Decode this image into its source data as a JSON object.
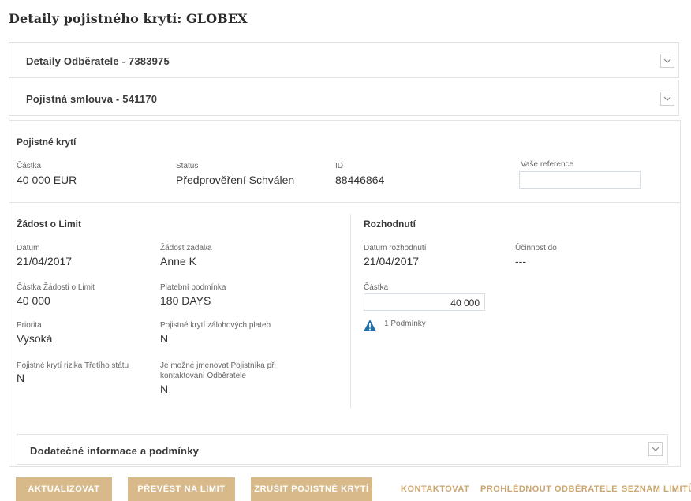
{
  "page": {
    "title": "Detaily pojistného krytí: GLOBEX"
  },
  "panels": {
    "customer": {
      "title": "Detaily Odběratele - 7383975"
    },
    "policy": {
      "title": "Pojistná smlouva - 541170"
    },
    "additional": {
      "title": "Dodatečné informace a podmínky"
    }
  },
  "coverage": {
    "title": "Pojistné krytí",
    "amount_label": "Částka",
    "amount_value": "40 000 EUR",
    "status_label": "Status",
    "status_value": "Předprověření Schválen",
    "id_label": "ID",
    "id_value": "88446864",
    "reference_label": "Vaše reference",
    "reference_value": ""
  },
  "request": {
    "title": "Žádost o Limit",
    "date_label": "Datum",
    "date_value": "21/04/2017",
    "requested_by_label": "Žádost zadal/a",
    "requested_by_value": "Anne K",
    "amount_label": "Částka Žádosti o Limit",
    "amount_value": "40 000",
    "payment_terms_label": "Platební podmínka",
    "payment_terms_value": "180 DAYS",
    "priority_label": "Priorita",
    "priority_value": "Vysoká",
    "advance_label": "Pojistné krytí zálohových plateb",
    "advance_value": "N",
    "third_country_label": "Pojistné krytí rizika Třetího státu",
    "third_country_value": "N",
    "name_insurer_label_1": "Je možné jmenovat Pojistníka při",
    "name_insurer_label_2": "kontaktování Odběratele",
    "name_insurer_value": "N"
  },
  "decision": {
    "title": "Rozhodnutí",
    "date_label": "Datum rozhodnutí",
    "date_value": "21/04/2017",
    "effective_label": "Účinnost do",
    "effective_value": "---",
    "amount_label": "Částka",
    "amount_value": "40 000",
    "conditions_text": "1 Podmínky"
  },
  "actions": {
    "update": "AKTUALIZOVAT",
    "convert": "PŘEVÉST NA LIMIT",
    "cancel": "ZRUŠIT POJISTNÉ KRYTÍ",
    "contact": "KONTAKTOVAT",
    "view_customer": "PROHLÉDNOUT ODBĚRATELE",
    "limit_list": "SEZNAM LIMITŮ"
  },
  "colors": {
    "accent": "#d7b98a",
    "link": "#caa66f",
    "warning_icon": "#1f6fa8"
  }
}
